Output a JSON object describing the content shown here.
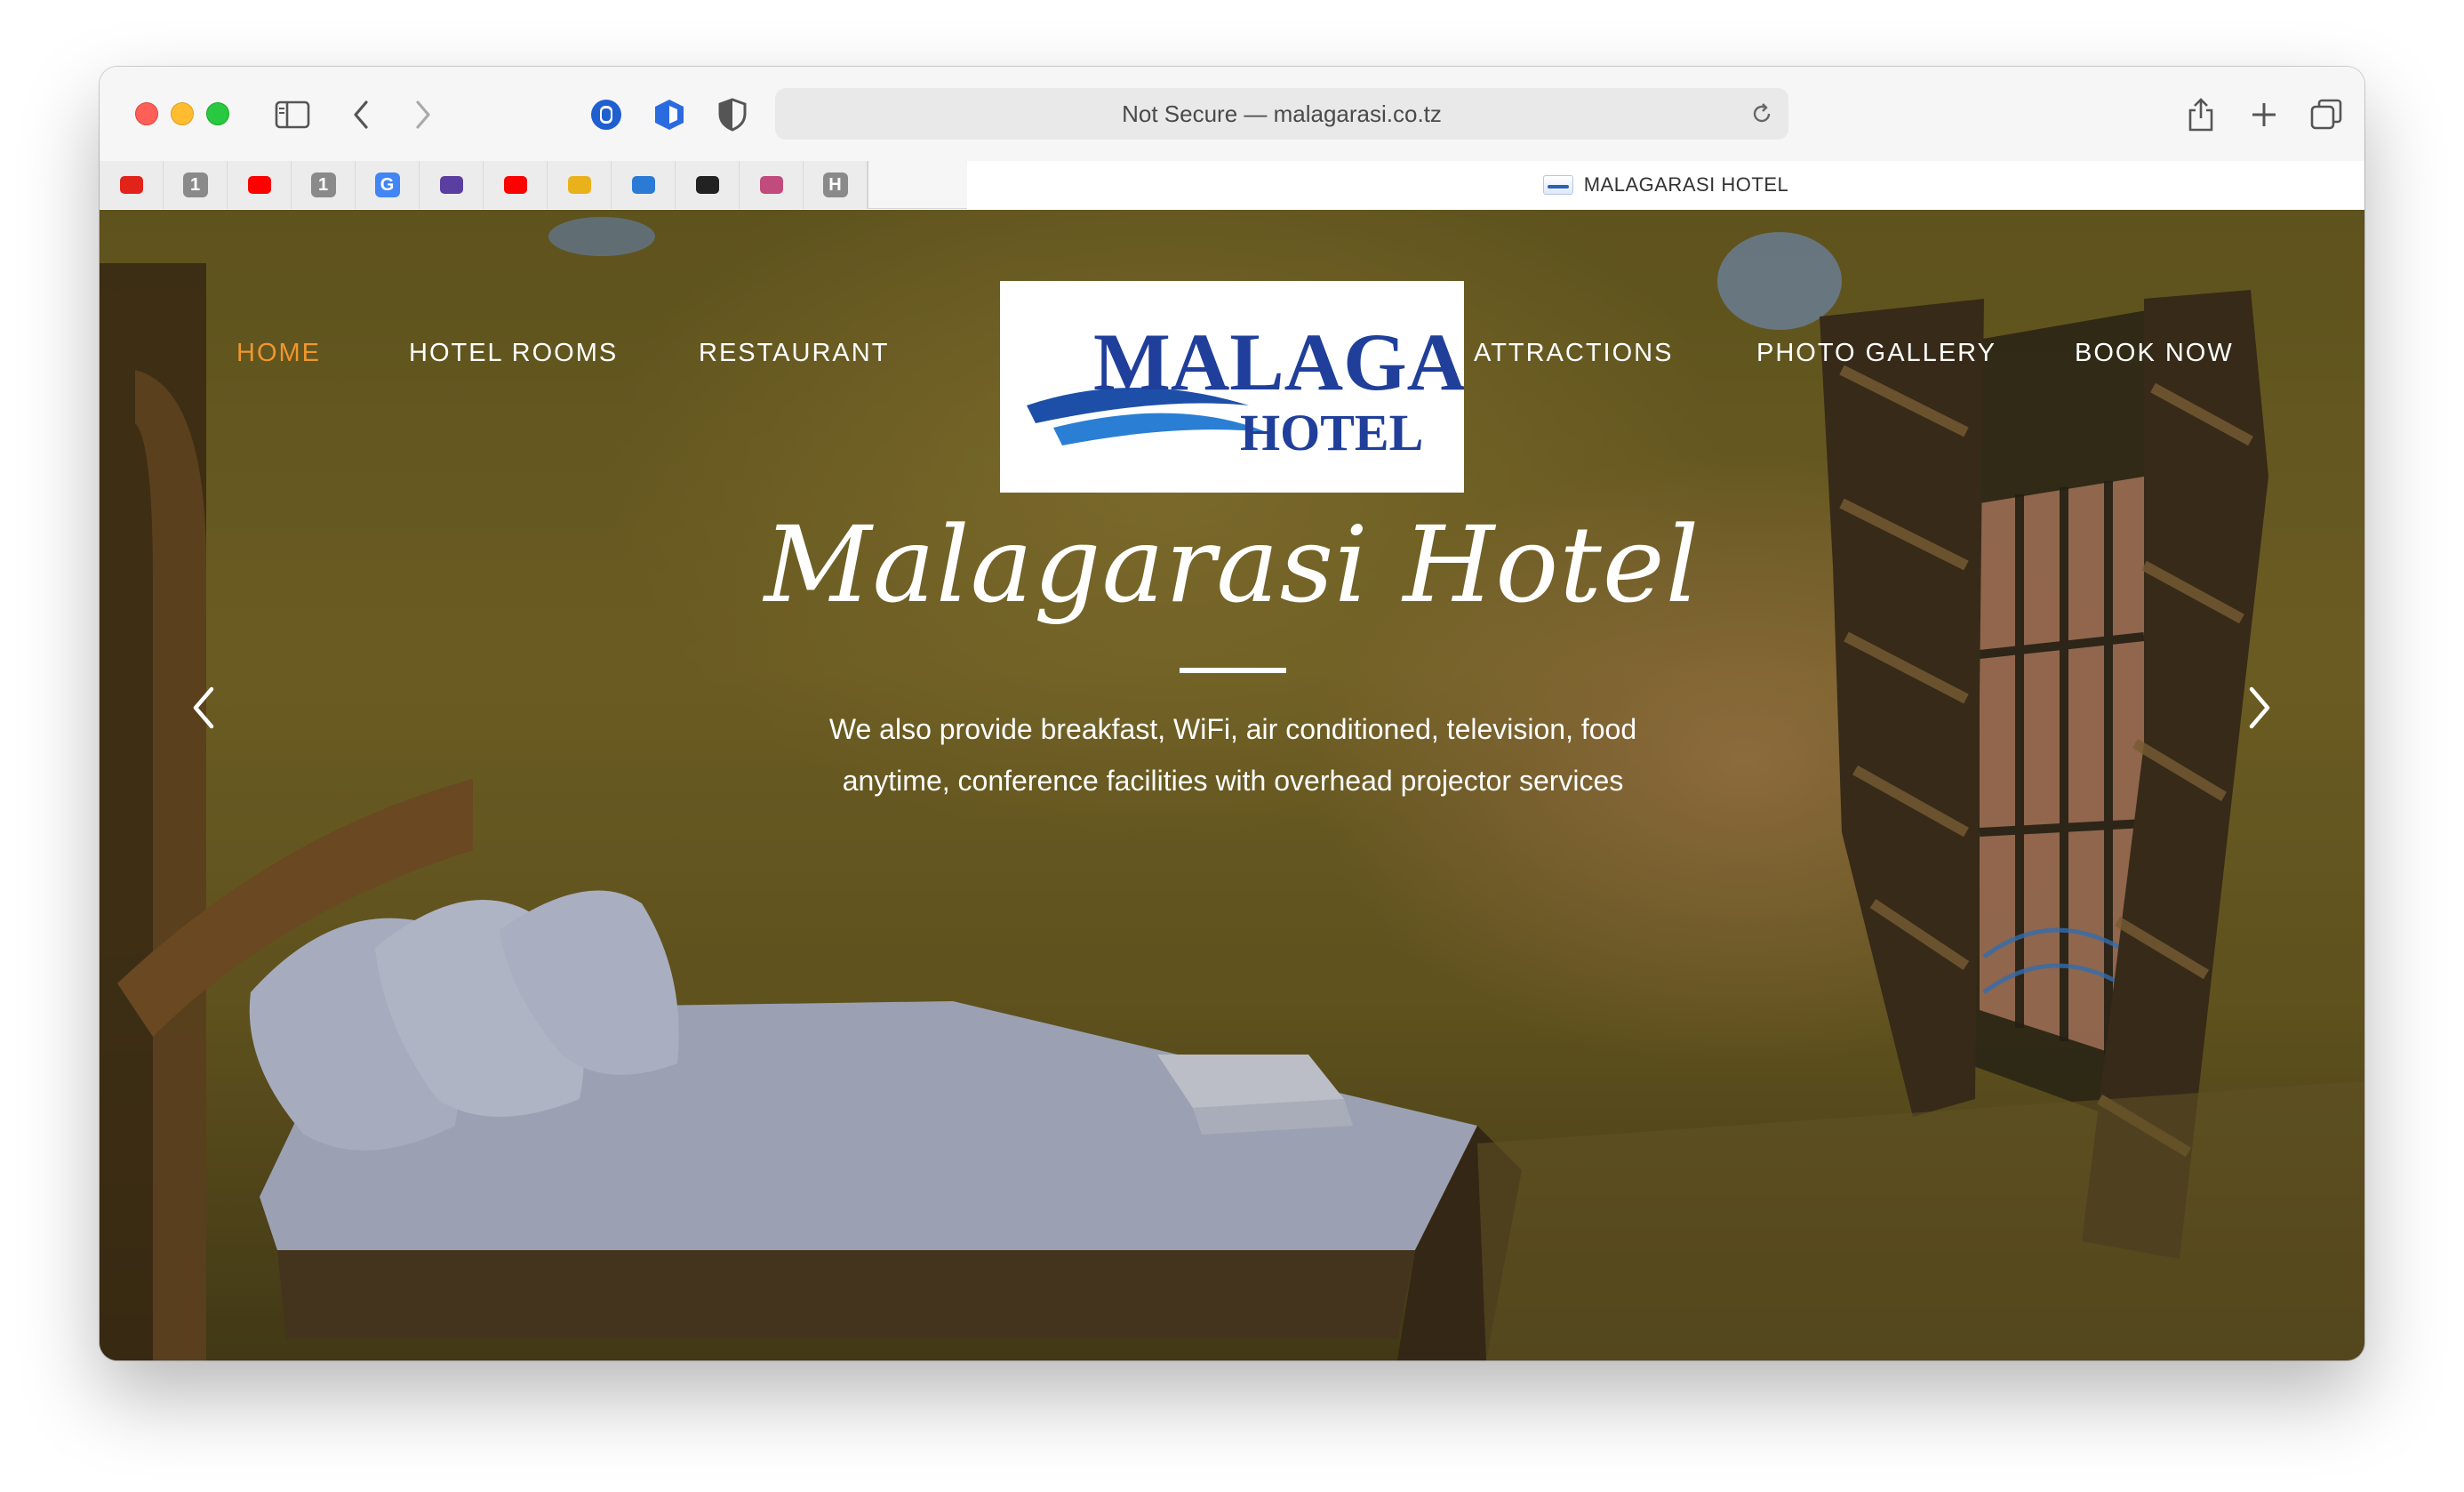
{
  "browser": {
    "address": "Not Secure — malagarasi.co.tz",
    "tab_title": "MALAGARASI HOTEL",
    "pinned_tabs": [
      {
        "icon": "huawei-icon",
        "color": "#e2231a",
        "text": ""
      },
      {
        "icon": "1password-icon",
        "color": "#8a8a8a",
        "text": "1"
      },
      {
        "icon": "youtube-icon",
        "color": "#ff0000",
        "text": ""
      },
      {
        "icon": "1password-icon",
        "color": "#8a8a8a",
        "text": "1"
      },
      {
        "icon": "google-icon",
        "color": "#4285f4",
        "text": "G"
      },
      {
        "icon": "bars-icon",
        "color": "#5b3fa0",
        "text": ""
      },
      {
        "icon": "youtube-icon",
        "color": "#ff0000",
        "text": ""
      },
      {
        "icon": "shield-logo-icon",
        "color": "#e9b21d",
        "text": ""
      },
      {
        "icon": "cloud-icon",
        "color": "#2b7bd6",
        "text": ""
      },
      {
        "icon": "portrait-icon",
        "color": "#222222",
        "text": ""
      },
      {
        "icon": "flower-icon",
        "color": "#c14b7c",
        "text": ""
      },
      {
        "icon": "h-letter-icon",
        "color": "#8a8a8a",
        "text": "H"
      }
    ]
  },
  "nav": {
    "home": "HOME",
    "rooms": "HOTEL ROOMS",
    "restaurant": "RESTAURANT",
    "attractions": "ATTRACTIONS",
    "gallery": "PHOTO GALLERY",
    "book": "BOOK NOW",
    "active_color": "#f0962e"
  },
  "logo": {
    "line1": "MALAGARASI",
    "line2": "HOTEL",
    "color": "#1f3f9a"
  },
  "hero": {
    "title": "Malagarasi Hotel",
    "text": "We also provide breakfast, WiFi, air conditioned, television, food anytime, conference facilities with overhead projector services"
  }
}
